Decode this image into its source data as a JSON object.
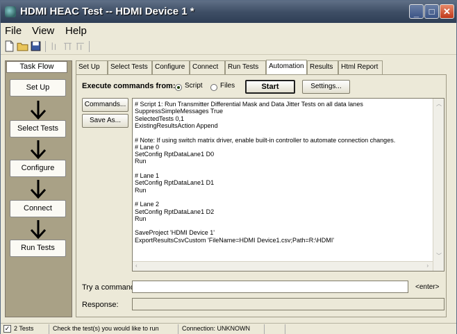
{
  "window": {
    "title": "HDMI HEAC Test -- HDMI Device 1 *",
    "controls": {
      "minimize": "_",
      "maximize": "□",
      "close": "✕"
    }
  },
  "menu": {
    "items": [
      "File",
      "View",
      "Help"
    ]
  },
  "toolbar": {
    "icons": [
      "new-file-icon",
      "open-folder-icon",
      "save-icon",
      "cut-icon",
      "paste-icon",
      "align-icon"
    ]
  },
  "taskflow": {
    "header": "Task Flow",
    "steps": [
      "Set Up",
      "Select Tests",
      "Configure",
      "Connect",
      "Run Tests"
    ]
  },
  "tabs": [
    "Set Up",
    "Select Tests",
    "Configure",
    "Connect",
    "Run Tests",
    "Automation",
    "Results",
    "Html Report"
  ],
  "active_tab": "Automation",
  "automation": {
    "execute_label": "Execute commands from:",
    "radio_script": "Script",
    "radio_files": "Files",
    "start_button": "Start",
    "settings_button": "Settings...",
    "commands_button": "Commands...",
    "saveas_button": "Save As...",
    "script_lines": [
      "# Script 1: Run Transmitter Differential Mask and Data Jitter Tests on all data lanes",
      "SuppressSimpleMessages True",
      "SelectedTests 0,1",
      "ExistingResultsAction Append",
      "",
      "# Note: If using switch matrix driver, enable built-in controller to automate connection changes.",
      "# Lane 0",
      "SetConfig RptDataLane1 D0",
      "Run",
      "",
      "# Lane 1",
      "SetConfig RptDataLane1 D1",
      "Run",
      "",
      "# Lane 2",
      "SetConfig RptDataLane1 D2",
      "Run",
      "",
      "SaveProject 'HDMI Device 1'",
      "ExportResultsCsvCustom 'FileName=HDMI Device1.csv;Path=R:\\HDMI'"
    ],
    "try_label": "Try a command:",
    "try_value": "",
    "enter_label": "<enter>",
    "response_label": "Response:",
    "response_value": ""
  },
  "status": {
    "tests": "2 Tests",
    "hint": "Check the test(s) you would like to run",
    "connection": "Connection: UNKNOWN"
  }
}
